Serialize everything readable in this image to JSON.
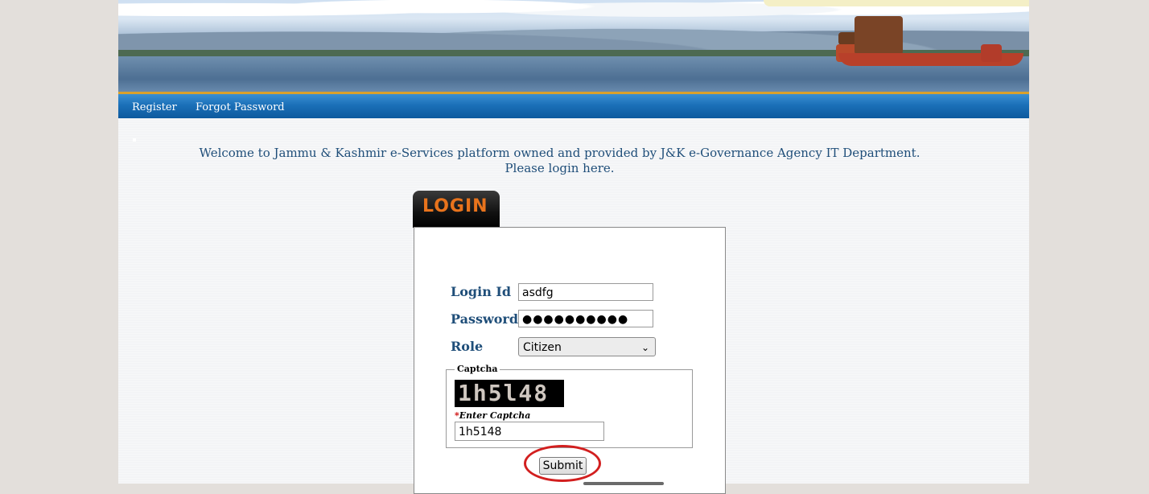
{
  "nav": {
    "register_label": "Register",
    "forgot_label": "Forgot Password"
  },
  "welcome": {
    "line1": "Welcome to Jammu & Kashmir e-Services platform owned and provided by J&K e-Governance Agency IT Department.",
    "line2": "Please login here."
  },
  "login": {
    "tab_label": "LOGIN",
    "login_id_label": "Login Id",
    "login_id_value": "asdfg",
    "password_label": "Password",
    "password_value": "●●●●●●●●●●",
    "role_label": "Role",
    "role_selected": "Citizen",
    "captcha_legend": "Captcha",
    "captcha_image_text": "1h5l48",
    "enter_captcha_required": "*",
    "enter_captcha_label": "Enter Captcha",
    "captcha_value": "1h5148",
    "submit_label": "Submit"
  },
  "colors": {
    "label_text": "#1f4e79",
    "nav_bar": "#1b70b8",
    "tab_text": "#e8731c",
    "highlight": "#d21f1f"
  }
}
